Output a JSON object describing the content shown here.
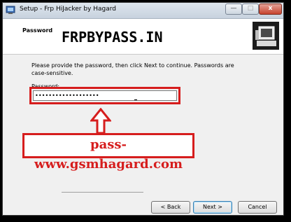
{
  "window": {
    "title": "Setup - Frp HiJacker by Hagard",
    "controls": {
      "minimize": "—",
      "maximize": "□",
      "close": "x"
    }
  },
  "header": {
    "title": "Password",
    "watermark": "FRPBYPASS.IN",
    "logo_icon": "computer-setup-icon"
  },
  "main": {
    "description": "Please provide the password, then click Next to continue. Passwords are case-sensitive.",
    "password_label": "Password:",
    "password_value": "•••••••••••••••••••",
    "annotation": "pass-www.gsmhagard.com",
    "annotation_color": "#d61d1d"
  },
  "footer": {
    "back_label": "< Back",
    "next_label": "Next >",
    "cancel_label": "Cancel"
  }
}
